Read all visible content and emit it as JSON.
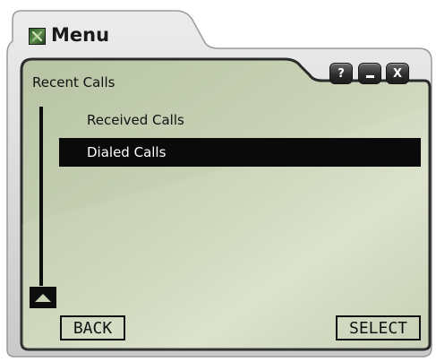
{
  "window": {
    "title": "Menu",
    "buttons": {
      "help_label": "?",
      "minimize_label": "–",
      "close_label": "X"
    }
  },
  "screen": {
    "header": "Recent Calls",
    "items": [
      {
        "label": "Received Calls",
        "selected": false
      },
      {
        "label": "Dialed Calls",
        "selected": true
      }
    ],
    "soft_keys": {
      "left": "BACK",
      "right": "SELECT"
    }
  },
  "colors": {
    "lcd_background": "#c4ceb2",
    "lcd_highlight": "#0a0a0a",
    "shell": "#d4d4d4"
  }
}
